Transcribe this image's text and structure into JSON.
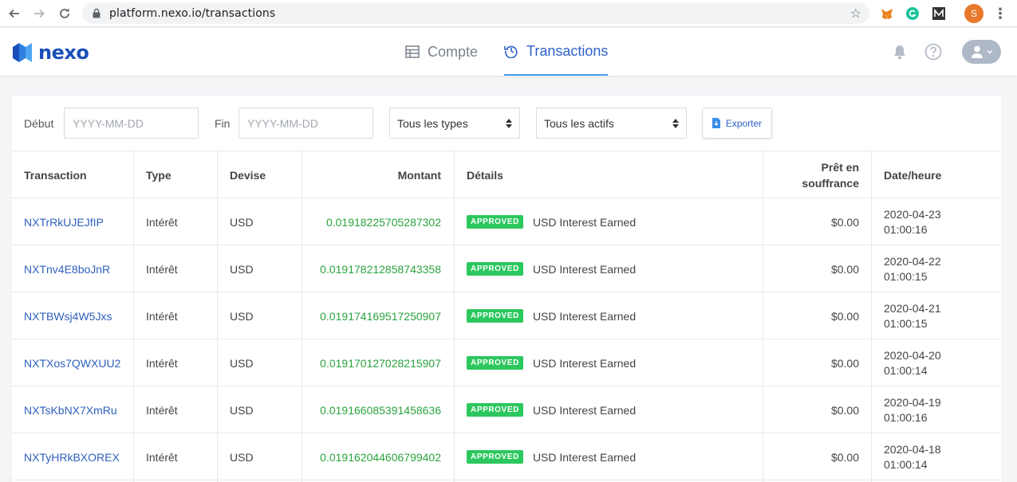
{
  "browser": {
    "url": "platform.nexo.io/transactions",
    "profile_initial": "S"
  },
  "header": {
    "logo_text": "nexo",
    "tabs": [
      {
        "label": "Compte",
        "active": false
      },
      {
        "label": "Transactions",
        "active": true
      }
    ]
  },
  "filters": {
    "start_label": "Début",
    "start_placeholder": "YYYY-MM-DD",
    "end_label": "Fin",
    "end_placeholder": "YYYY-MM-DD",
    "type_select": "Tous les types",
    "asset_select": "Tous les actifs",
    "export_label": "Exporter"
  },
  "table": {
    "columns": {
      "transaction": "Transaction",
      "type": "Type",
      "currency": "Devise",
      "amount": "Montant",
      "details": "Détails",
      "outstanding_line1": "Prêt en",
      "outstanding_line2": "souffrance",
      "datetime": "Date/heure"
    },
    "rows": [
      {
        "id": "NXTrRkUJEJfIP",
        "type": "Intérêt",
        "currency": "USD",
        "amount": "0.01918225705287302",
        "status": "APPROVED",
        "details": "USD Interest Earned",
        "outstanding": "$0.00",
        "date": "2020-04-23",
        "time": "01:00:16"
      },
      {
        "id": "NXTnv4E8boJnR",
        "type": "Intérêt",
        "currency": "USD",
        "amount": "0.019178212858743358",
        "status": "APPROVED",
        "details": "USD Interest Earned",
        "outstanding": "$0.00",
        "date": "2020-04-22",
        "time": "01:00:15"
      },
      {
        "id": "NXTBWsj4W5Jxs",
        "type": "Intérêt",
        "currency": "USD",
        "amount": "0.019174169517250907",
        "status": "APPROVED",
        "details": "USD Interest Earned",
        "outstanding": "$0.00",
        "date": "2020-04-21",
        "time": "01:00:15"
      },
      {
        "id": "NXTXos7QWXUU2",
        "type": "Intérêt",
        "currency": "USD",
        "amount": "0.019170127028215907",
        "status": "APPROVED",
        "details": "USD Interest Earned",
        "outstanding": "$0.00",
        "date": "2020-04-20",
        "time": "01:00:14"
      },
      {
        "id": "NXTsKbNX7XmRu",
        "type": "Intérêt",
        "currency": "USD",
        "amount": "0.019166085391458636",
        "status": "APPROVED",
        "details": "USD Interest Earned",
        "outstanding": "$0.00",
        "date": "2020-04-19",
        "time": "01:00:16"
      },
      {
        "id": "NXTyHRkBXOREX",
        "type": "Intérêt",
        "currency": "USD",
        "amount": "0.019162044606799402",
        "status": "APPROVED",
        "details": "USD Interest Earned",
        "outstanding": "$0.00",
        "date": "2020-04-18",
        "time": "01:00:14"
      }
    ]
  },
  "colors": {
    "brand_blue": "#1a4fba",
    "link_blue": "#2f5fbf",
    "amount_green": "#2aa33f",
    "badge_green": "#2cc75e"
  }
}
